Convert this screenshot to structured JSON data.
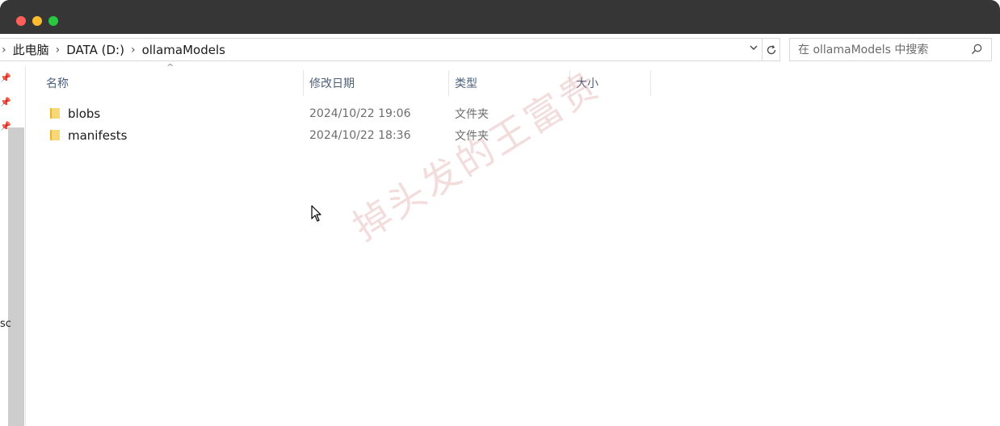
{
  "breadcrumb": {
    "items": [
      "此电脑",
      "DATA (D:)",
      "ollamaModels"
    ]
  },
  "search": {
    "placeholder": "在 ollamaModels 中搜索"
  },
  "columns": {
    "name": "名称",
    "date": "修改日期",
    "type": "类型",
    "size": "大小"
  },
  "files": [
    {
      "name": "blobs",
      "date": "2024/10/22 19:06",
      "type": "文件夹"
    },
    {
      "name": "manifests",
      "date": "2024/10/22 18:36",
      "type": "文件夹"
    }
  ],
  "nav": {
    "partial_label": "sc"
  },
  "watermark": "掉头发的王富贵",
  "colors": {
    "titlebar": "#363636",
    "folder": "#f8c84a",
    "header_text": "#4c607a"
  }
}
